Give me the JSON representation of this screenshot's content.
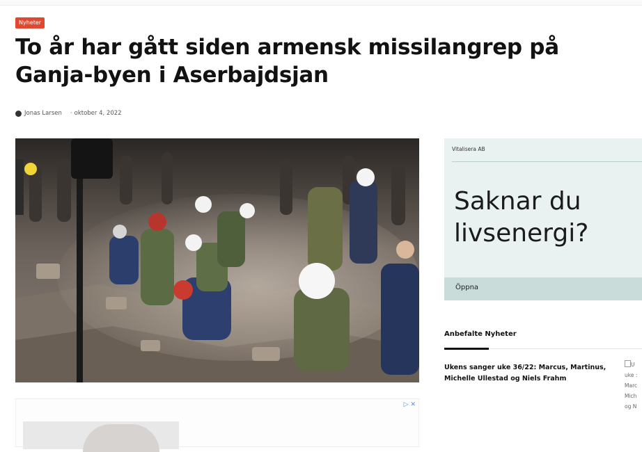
{
  "category_badge": "Nyheter",
  "article": {
    "title": "To år har gått siden armensk missilangrep på Ganja-byen i Aserbajdsjan",
    "author": "Jonas Larsen",
    "date": "oktober 4, 2022"
  },
  "ad_inline": {
    "icons": "▷ ✕"
  },
  "sidebar_ad": {
    "sponsor": "Vitalisera AB",
    "headline": "Saknar du livsenergi?",
    "cta": "Öppna"
  },
  "recommended": {
    "heading": "Anbefalte Nyheter",
    "items": [
      {
        "title": "Ukens sanger uke 36/22: Marcus, Martinus, Michelle Ullestad og Niels Frahm",
        "thumb_alt_lines": [
          "U",
          "uke :",
          "Marc",
          "Mich",
          "og N"
        ]
      }
    ]
  }
}
